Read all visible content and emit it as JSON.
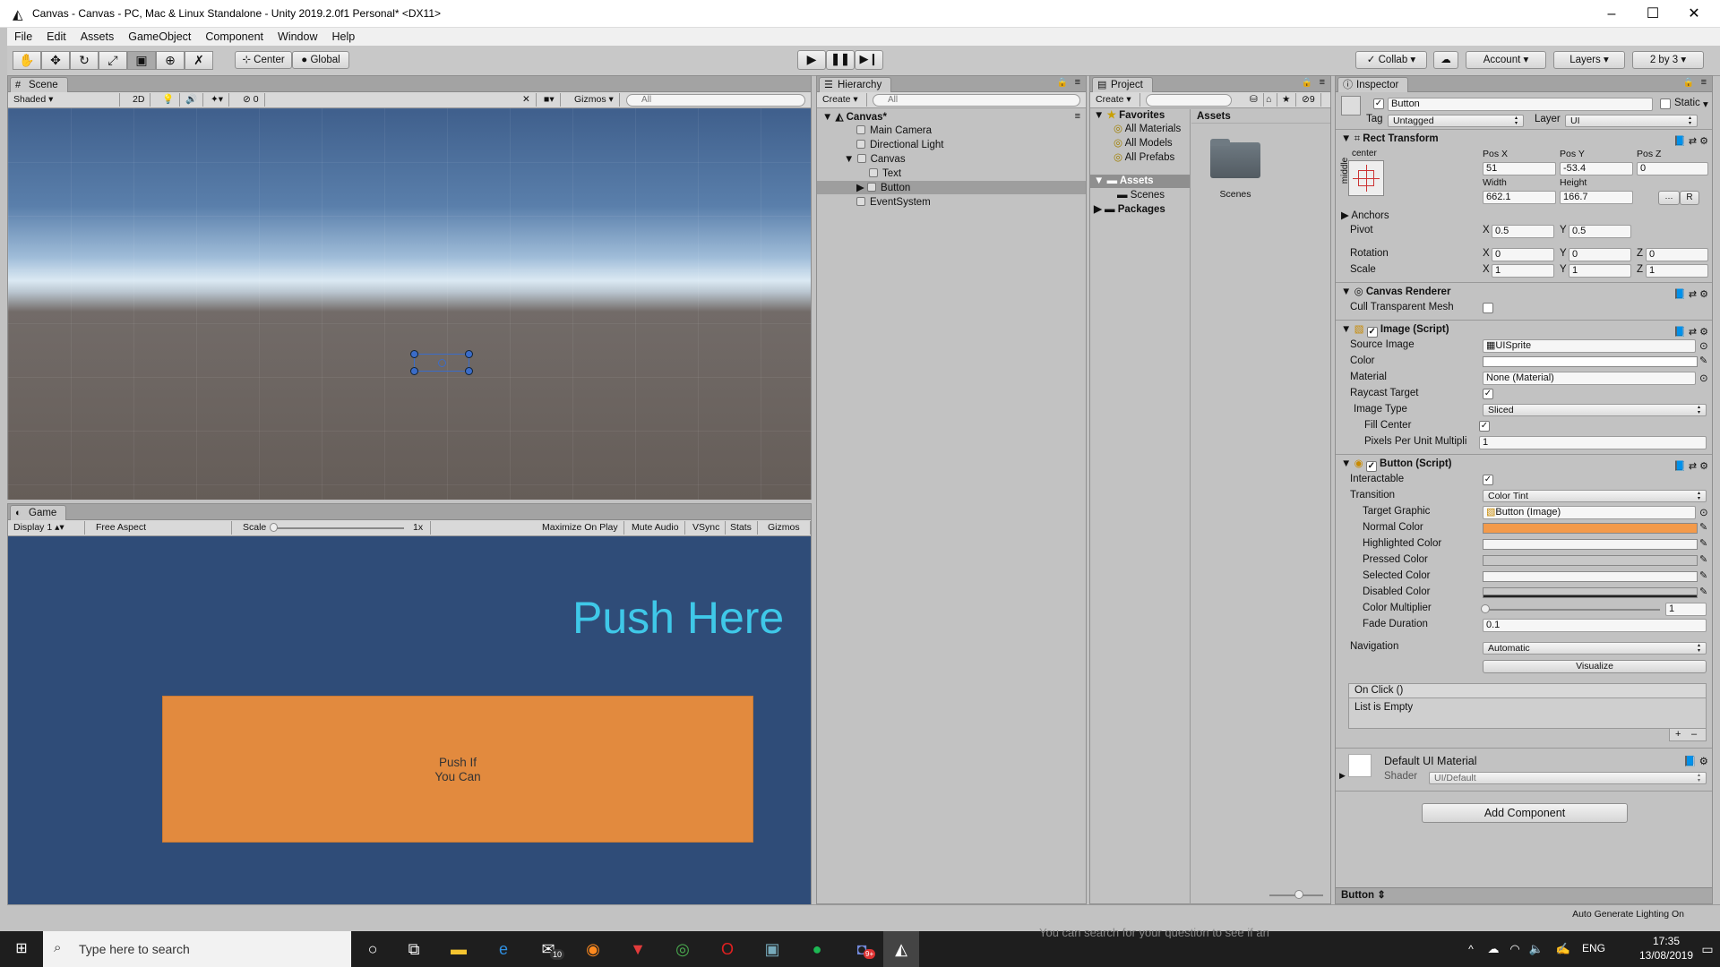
{
  "window": {
    "title": "Canvas - Canvas - PC, Mac & Linux Standalone - Unity 2019.2.0f1 Personal* <DX11>"
  },
  "menu": [
    "File",
    "Edit",
    "Assets",
    "GameObject",
    "Component",
    "Window",
    "Help"
  ],
  "toolbar": {
    "tools": [
      "hand-tool",
      "move-tool",
      "rotate-tool",
      "scale-tool",
      "rect-tool",
      "transform-tool",
      "custom-tool"
    ],
    "center_label": "Center",
    "global_label": "Global",
    "collab_label": "Collab",
    "account_label": "Account",
    "layers_label": "Layers",
    "layout_label": "2 by 3"
  },
  "scene": {
    "tab": "Scene",
    "shading": "Shaded",
    "mode_2d": "2D",
    "fx_count": "0",
    "gizmos": "Gizmos",
    "search_placeholder": "All"
  },
  "game": {
    "tab": "Game",
    "display": "Display 1",
    "aspect": "Free Aspect",
    "scale_label": "Scale",
    "scale_value": "1x",
    "buttons": [
      "Maximize On Play",
      "Mute Audio",
      "VSync",
      "Stats",
      "Gizmos"
    ],
    "heading_text": "Push Here",
    "button_text_1": "Push If",
    "button_text_2": "You Can",
    "heading_color": "#3fc8e8",
    "bg_color": "#2f4c78",
    "button_color": "#e28a3e"
  },
  "hierarchy": {
    "tab": "Hierarchy",
    "create": "Create",
    "search_placeholder": "All",
    "root": "Canvas*",
    "items": [
      "Main Camera",
      "Directional Light",
      "Canvas",
      "Text",
      "Button",
      "EventSystem"
    ]
  },
  "project": {
    "tab": "Project",
    "create": "Create",
    "hidden_count": "9",
    "favorites": "Favorites",
    "fav_items": [
      "All Materials",
      "All Models",
      "All Prefabs"
    ],
    "assets": "Assets",
    "scenes": "Scenes",
    "packages": "Packages",
    "assets_header": "Assets",
    "folder_label": "Scenes"
  },
  "inspector": {
    "tab": "Inspector",
    "object_name": "Button",
    "static_label": "Static",
    "tag_label": "Tag",
    "tag_value": "Untagged",
    "layer_label": "Layer",
    "layer_value": "UI",
    "rect": {
      "title": "Rect Transform",
      "anchor_h": "center",
      "anchor_v": "middle",
      "posx_label": "Pos X",
      "posy_label": "Pos Y",
      "posz_label": "Pos Z",
      "posx": "51",
      "posy": "-53.4",
      "posz": "0",
      "width_label": "Width",
      "height_label": "Height",
      "width": "662.1",
      "height": "166.7",
      "anchors_label": "Anchors",
      "pivot_label": "Pivot",
      "pivot_x": "0.5",
      "pivot_y": "0.5",
      "rotation_label": "Rotation",
      "rot_x": "0",
      "rot_y": "0",
      "rot_z": "0",
      "scale_label": "Scale",
      "scale_x": "1",
      "scale_y": "1",
      "scale_z": "1",
      "r_label": "R"
    },
    "canvas_renderer": {
      "title": "Canvas Renderer",
      "cull_label": "Cull Transparent Mesh"
    },
    "image": {
      "title": "Image (Script)",
      "source_label": "Source Image",
      "source_value": "UISprite",
      "color_label": "Color",
      "material_label": "Material",
      "material_value": "None (Material)",
      "raycast_label": "Raycast Target",
      "type_label": "Image Type",
      "type_value": "Sliced",
      "fill_label": "Fill Center",
      "ppu_label": "Pixels Per Unit Multipli",
      "ppu_value": "1"
    },
    "button": {
      "title": "Button (Script)",
      "interactable_label": "Interactable",
      "transition_label": "Transition",
      "transition_value": "Color Tint",
      "target_label": "Target Graphic",
      "target_value": "Button (Image)",
      "normal_label": "Normal Color",
      "normal_color": "#f39a4a",
      "highlighted_label": "Highlighted Color",
      "pressed_label": "Pressed Color",
      "selected_label": "Selected Color",
      "disabled_label": "Disabled Color",
      "multiplier_label": "Color Multiplier",
      "multiplier_value": "1",
      "fade_label": "Fade Duration",
      "fade_value": "0.1",
      "navigation_label": "Navigation",
      "navigation_value": "Automatic",
      "visualize_label": "Visualize",
      "onclick_label": "On Click ()",
      "empty_label": "List is Empty"
    },
    "material": {
      "title": "Default UI Material",
      "shader_label": "Shader",
      "shader_value": "UI/Default"
    },
    "add_component": "Add Component",
    "footer_label": "Button"
  },
  "status": {
    "lighting": "Auto Generate Lighting On",
    "overlay_text": "You can search for your question to see if an"
  },
  "taskbar": {
    "search_placeholder": "Type here to search",
    "mail_badge": "10",
    "discord_badge": "9+",
    "lang": "ENG",
    "time": "17:35",
    "date": "13/08/2019"
  }
}
